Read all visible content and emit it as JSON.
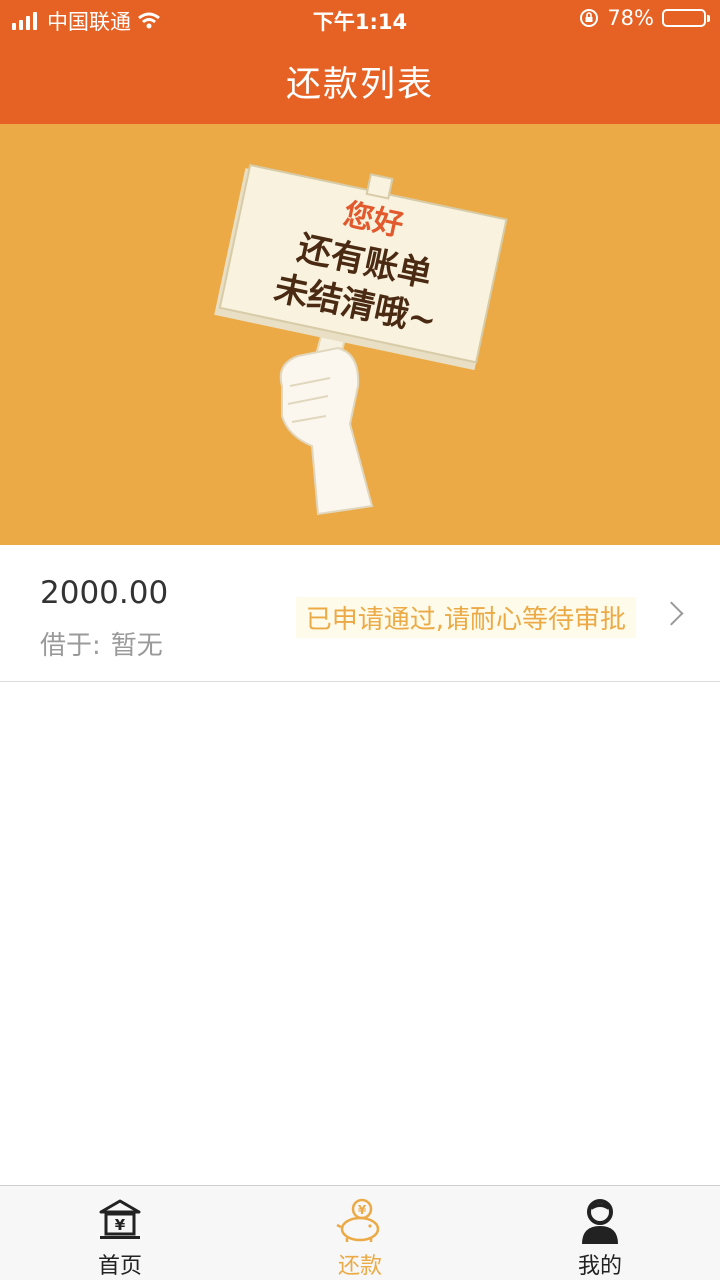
{
  "status_bar": {
    "carrier": "中国联通",
    "time": "下午1:14",
    "battery": "78%",
    "battery_level": 0.78
  },
  "header": {
    "title": "还款列表"
  },
  "banner": {
    "line1": "您好",
    "line2": "还有账单",
    "line3": "未结清哦~"
  },
  "loan_list": [
    {
      "amount": "2000.00",
      "lender_label": "借于:",
      "lender_value": "暂无",
      "status": "已申请通过,请耐心等待审批"
    }
  ],
  "tabbar": {
    "items": [
      {
        "label": "首页",
        "icon": "bank-icon",
        "active": false
      },
      {
        "label": "还款",
        "icon": "piggy-bank-icon",
        "active": true
      },
      {
        "label": "我的",
        "icon": "user-icon",
        "active": false
      }
    ]
  },
  "colors": {
    "header": "#E66224",
    "banner": "#EBAA46",
    "accent": "#EBAA46"
  }
}
